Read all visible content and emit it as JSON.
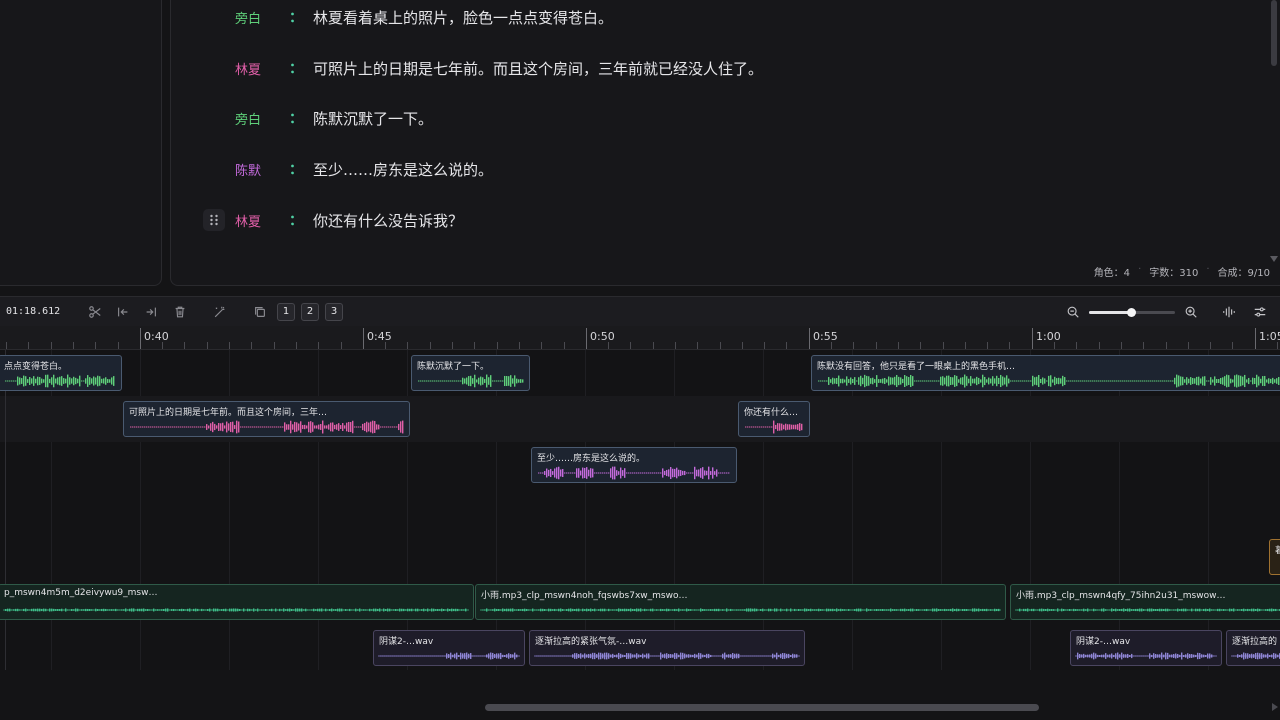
{
  "script": {
    "lines": [
      {
        "speaker": "旁白",
        "text": "林夏看着桌上的照片，脸色一点点变得苍白。"
      },
      {
        "speaker": "林夏",
        "text": "可照片上的日期是七年前。而且这个房间，三年前就已经没人住了。"
      },
      {
        "speaker": "旁白",
        "text": "陈默沉默了一下。"
      },
      {
        "speaker": "陈默",
        "text": "至少……房东是这么说的。"
      },
      {
        "speaker": "林夏",
        "text": "你还有什么没告诉我？"
      }
    ],
    "colon": "：",
    "stats": {
      "roles": "角色：4",
      "chars": "字数：310",
      "synth": "合成：9/10"
    }
  },
  "toolbar": {
    "time": "01:18.612",
    "track_buttons": [
      "1",
      "2",
      "3"
    ],
    "zoom_level": 0.49
  },
  "ruler": {
    "labels": [
      "0:40",
      "0:45",
      "0:50",
      "0:55",
      "1:00",
      "1:05"
    ]
  },
  "clips": {
    "narrator": [
      {
        "label": "点点变得苍白。"
      },
      {
        "label": "陈默沉默了一下。"
      },
      {
        "label": "陈默没有回答，他只是看了一眼桌上的黑色手机…"
      }
    ],
    "linxia": [
      {
        "label": "可照片上的日期是七年前。而且这个房间，三年…"
      },
      {
        "label": "你还有什么…"
      }
    ],
    "chenmo": [
      {
        "label": "至少……房东是这么说的。"
      }
    ],
    "orange": [
      {
        "label": "暮"
      }
    ],
    "bgm": [
      {
        "label": "p_mswn4m5m_d2eivywu9_msw…"
      },
      {
        "label": "小雨.mp3_clp_mswn4noh_fqswbs7xw_mswo…"
      },
      {
        "label": "小雨.mp3_clp_mswn4qfy_75ihn2u31_mswow…"
      }
    ],
    "sfx": [
      {
        "label": "阴谋2-…wav"
      },
      {
        "label": "逐渐拉高的紧张气氛-…wav"
      },
      {
        "label": "阴谋2-…wav"
      },
      {
        "label": "逐渐拉高的"
      }
    ]
  },
  "colors": {
    "narrator": "#5fd07a",
    "linxia": "#e05fa8",
    "chenmo": "#c46bdc",
    "bgm": "#3fbf8a",
    "sfx": "#8f86d6",
    "accent": "#4fd1a5"
  }
}
